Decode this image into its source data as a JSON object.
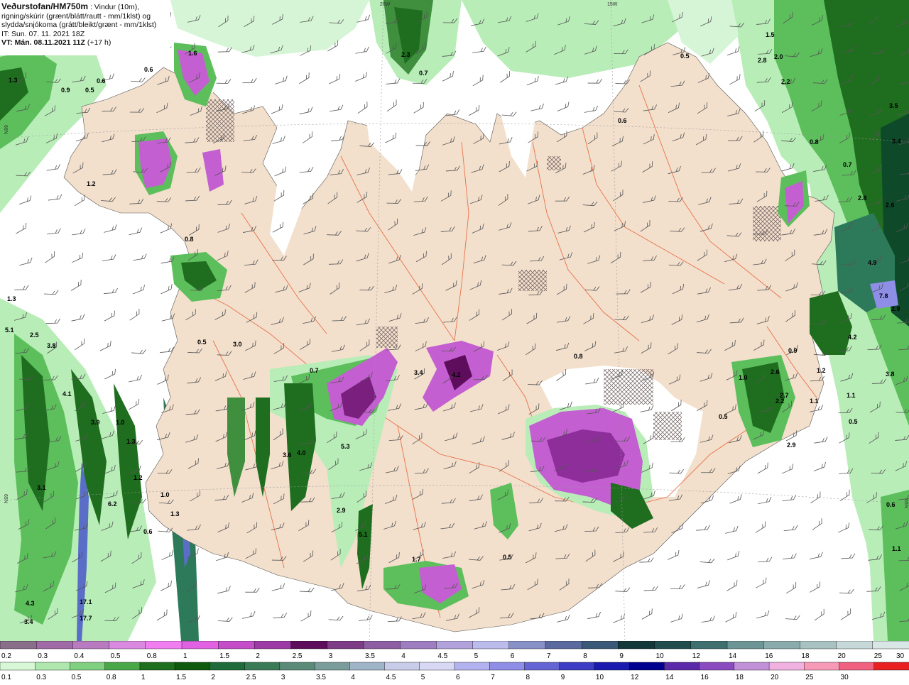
{
  "header": {
    "title": "Veðurstofan/HM750m",
    "title_suffix": " : Vindur (10m),",
    "line2": "rigning/skúrir (grænt/blátt/rautt - mm/1klst) og",
    "line3": "slydda/snjókoma (grátt/bleikt/grænt - mm/1klst)",
    "it": "IT: Sun. 07. 11. 2021 18Z",
    "vt": "VT: Mán. 08.11.2021 11Z",
    "vt_offset": "(+17 h)"
  },
  "grid_labels": {
    "lon_20w": "20W",
    "lon_15w": "15W",
    "lat_66n_left": "66N",
    "lat_66n_right": "66N",
    "lat_65n_left": "65N",
    "lat_65n_right": "65N"
  },
  "map_values": [
    {
      "t": "1.3"
    },
    {
      "t": "0.9"
    },
    {
      "t": "0.5"
    },
    {
      "t": "0.6"
    },
    {
      "t": "1.6"
    },
    {
      "t": "0.6"
    },
    {
      "t": "2.3"
    },
    {
      "t": "0.7"
    },
    {
      "t": "0.5"
    },
    {
      "t": "2.8"
    },
    {
      "t": "2.0"
    },
    {
      "t": "2.2"
    },
    {
      "t": "1.5"
    },
    {
      "t": "3.5"
    },
    {
      "t": "3.4"
    },
    {
      "t": "0.6"
    },
    {
      "t": "0.8"
    },
    {
      "t": "0.7"
    },
    {
      "t": "2.8"
    },
    {
      "t": "2.6"
    },
    {
      "t": "4.9"
    },
    {
      "t": "2.9"
    },
    {
      "t": "7.8"
    },
    {
      "t": "0.9"
    },
    {
      "t": "1.0"
    },
    {
      "t": "1.1"
    },
    {
      "t": "0.5"
    },
    {
      "t": "0.6"
    },
    {
      "t": "1.1"
    },
    {
      "t": "2.9"
    },
    {
      "t": "0.5"
    },
    {
      "t": "3.8"
    },
    {
      "t": "4.2"
    },
    {
      "t": "2.7"
    },
    {
      "t": "1.2"
    },
    {
      "t": "1.1"
    },
    {
      "t": "0.5"
    },
    {
      "t": "0.8"
    },
    {
      "t": "0.8"
    },
    {
      "t": "1.3"
    },
    {
      "t": "5.1"
    },
    {
      "t": "2.5"
    },
    {
      "t": "3.8"
    },
    {
      "t": "4.1"
    },
    {
      "t": "3.9"
    },
    {
      "t": "1.0"
    },
    {
      "t": "1.3"
    },
    {
      "t": "1.2"
    },
    {
      "t": "3.1"
    },
    {
      "t": "6.2"
    },
    {
      "t": "1.0"
    },
    {
      "t": "4.3"
    },
    {
      "t": "3.4"
    },
    {
      "t": "17.1"
    },
    {
      "t": "17.7"
    },
    {
      "t": "3.4"
    },
    {
      "t": "5.3"
    },
    {
      "t": "4.2"
    },
    {
      "t": "2.9"
    },
    {
      "t": "1.3"
    },
    {
      "t": "0.6"
    },
    {
      "t": "0.5"
    },
    {
      "t": "3.0"
    },
    {
      "t": "3.6"
    },
    {
      "t": "4.0"
    },
    {
      "t": "5.1"
    },
    {
      "t": "2.6"
    },
    {
      "t": "2.2"
    },
    {
      "t": "1.2"
    },
    {
      "t": "0.7"
    },
    {
      "t": "1.7"
    }
  ],
  "legend": {
    "snow": {
      "labels": [
        "0.2",
        "0.3",
        "0.4",
        "0.5",
        "0.8",
        "1",
        "1.5",
        "2",
        "2.5",
        "3",
        "3.5",
        "4",
        "4.5",
        "5",
        "6",
        "7",
        "8",
        "9",
        "10",
        "12",
        "14",
        "16",
        "18",
        "20",
        "25",
        "30"
      ],
      "colors": [
        "#8a6f8a",
        "#a06aa6",
        "#b97bbf",
        "#d98ae0",
        "#f07ef0",
        "#e061e2",
        "#c44ec8",
        "#9d3ba6",
        "#5e0d5c",
        "#7c3c86",
        "#8e5ea3",
        "#9e7ec0",
        "#b1a2dc",
        "#bcbcec",
        "#8890c8",
        "#5a6a9e",
        "#3a5877",
        "#12383a",
        "#214d4f",
        "#3f6f6f",
        "#6e9595",
        "#8aabab",
        "#a8c2c2",
        "#c6d8d8",
        "#d9e6e6"
      ]
    },
    "rain": {
      "labels": [
        "0.1",
        "0.3",
        "0.5",
        "0.8",
        "1",
        "1.5",
        "2",
        "2.5",
        "3",
        "3.5",
        "4",
        "4.5",
        "5",
        "6",
        "7",
        "8",
        "9",
        "10",
        "12",
        "14",
        "16",
        "18",
        "20",
        "25",
        "30"
      ],
      "colors": [
        "#d7f7d7",
        "#aee8ae",
        "#7fd07f",
        "#48a848",
        "#1d6e1d",
        "#0e5a0e",
        "#1f6b3c",
        "#3b7a57",
        "#5a8a78",
        "#7a9c9a",
        "#a0b4c8",
        "#c8cce8",
        "#d8d8f4",
        "#b2b2f0",
        "#8e8ee6",
        "#6464d4",
        "#3c3cc4",
        "#1a1ab0",
        "#000090",
        "#5a2aa8",
        "#8a4ac0",
        "#c090d8",
        "#f0b0e0",
        "#f79ab8",
        "#f06080",
        "#e82020"
      ]
    }
  },
  "colors": {
    "land": "#f2dfcc",
    "ocean": "#ffffff",
    "rain_light": "#b8edb8",
    "rain_mid": "#5cbf5c",
    "rain_dark": "#1f6e1f",
    "snow_purple": "#c35fd0",
    "snow_dark": "#7a1f7e",
    "roads": "#e8734a"
  }
}
